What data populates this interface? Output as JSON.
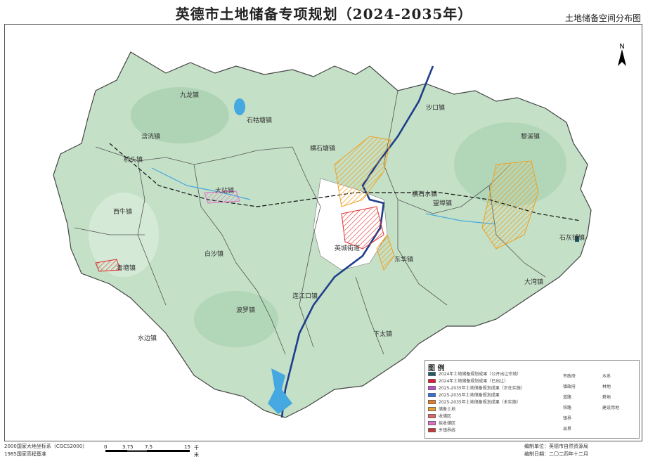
{
  "title": "英德市土地储备专项规划（2024-2035年）",
  "subtitle": "土地储备空间分布图",
  "towns": [
    "连江口镇",
    "石牯塘镇",
    "沙口镇",
    "九龙镇",
    "横石塘镇",
    "浛洸镇",
    "桥头镇",
    "黎溪镇",
    "横石水镇",
    "大站镇",
    "英城街道",
    "西牛镇",
    "东华镇",
    "青塘镇",
    "望埠镇",
    "白沙镇",
    "大湾镇",
    "下太镇",
    "石灰铺镇",
    "波罗镇",
    "水边镇"
  ],
  "legend": {
    "title": "图 例",
    "items": [
      {
        "label": "2024年土地储备规划成果（公开出让宗地）",
        "color": "#1a5c6b"
      },
      {
        "label": "2024年土地储备规划成果（已出让）",
        "color": "#e8182a"
      },
      {
        "label": "2025-2035年土地储备规划成果（正在实施）",
        "color": "#c84bd4"
      },
      {
        "label": "2025-2035年土地储备规划成果",
        "color": "#2f6fe8"
      },
      {
        "label": "2025-2035年土地储备规划成果（未实施）",
        "color": "#f07a1a"
      },
      {
        "label": "储备土地",
        "color": "#f0a020"
      },
      {
        "label": "收储区",
        "color": "#e86060"
      },
      {
        "label": "拟收储区",
        "color": "#e070c8"
      },
      {
        "label": "乡镇界线",
        "color": "#d03030"
      }
    ],
    "right_items": [
      "市政府",
      "镇政府",
      "道路",
      "铁路",
      "镇界",
      "县界",
      "水系",
      "林地",
      "耕地",
      "建设用地"
    ],
    "colors": {
      "water": "#1f9cd6",
      "forest": "#8fd08f",
      "construction": "#d8d8d8"
    }
  },
  "footer": {
    "crs": "2000国家大地坐标系（CGCS2000）",
    "elev": "1985国家高程基准",
    "unit": "编制单位：英德市自然资源局",
    "date": "编制日期：二〇二四年十二月"
  },
  "scale": {
    "labels": [
      "0",
      "3.75",
      "7.5",
      "15"
    ],
    "unit": "千米"
  },
  "north_label": "N",
  "map_colors": {
    "land": "#c4e0c7",
    "hill": "#a6cfae",
    "urban": "#ffffff",
    "river": "#1e3e8c",
    "water": "#45a8e0"
  }
}
